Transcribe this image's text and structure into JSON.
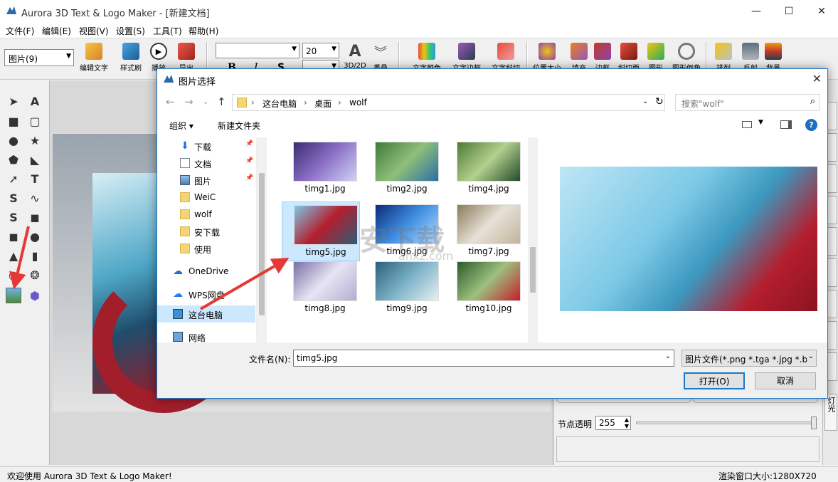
{
  "window": {
    "title": "Aurora 3D Text & Logo Maker - [新建文档]",
    "controls": [
      "minimize-icon",
      "maximize-icon",
      "close-icon"
    ]
  },
  "menu": [
    "文件(F)",
    "编辑(E)",
    "视图(V)",
    "设置(S)",
    "工具(T)",
    "帮助(H)"
  ],
  "toolbar": {
    "type_combo": "图片(9)",
    "font_size": "20",
    "buttons": [
      "编辑文字",
      "样式刷",
      "播放",
      "导出"
    ],
    "format_labels": [
      "B",
      "I",
      "S"
    ],
    "align_labels": [
      "3D/2D",
      "重叠"
    ],
    "text_buttons": [
      "文字颜色",
      "文字边框",
      "文字斜切"
    ],
    "shape_buttons": [
      "位置大小",
      "填充",
      "边框",
      "斜切面",
      "图形",
      "图形倒角"
    ],
    "scene_buttons": [
      "排列",
      "反射",
      "背景"
    ]
  },
  "right_panel": {
    "node_opacity_label": "节点透明",
    "node_opacity_value": "255",
    "tab_bottom_label": "灯光"
  },
  "status": {
    "welcome": "欢迎使用 Aurora 3D Text & Logo Maker!",
    "render_size": "渲染窗口大小:1280X720"
  },
  "dialog": {
    "title": "图片选择",
    "breadcrumb": [
      "这台电脑",
      "桌面",
      "wolf"
    ],
    "search_placeholder": "搜索\"wolf\"",
    "organize": "组织 ▾",
    "new_folder": "新建文件夹",
    "tree": [
      {
        "label": "下载",
        "icon": "download-icon",
        "pinned": true
      },
      {
        "label": "文档",
        "icon": "document-icon",
        "pinned": true
      },
      {
        "label": "图片",
        "icon": "picture-folder-icon",
        "pinned": true
      },
      {
        "label": "WeiC",
        "icon": "folder-icon",
        "pinned": false
      },
      {
        "label": "wolf",
        "icon": "folder-icon",
        "pinned": false
      },
      {
        "label": "安下载",
        "icon": "folder-icon",
        "pinned": false
      },
      {
        "label": "使用",
        "icon": "folder-icon",
        "pinned": false
      },
      {
        "label": "OneDrive",
        "icon": "cloud-icon",
        "pinned": false
      },
      {
        "label": "WPS网盘",
        "icon": "cloud-icon",
        "pinned": false
      },
      {
        "label": "这台电脑",
        "icon": "computer-icon",
        "pinned": false,
        "selected": true
      },
      {
        "label": "网络",
        "icon": "network-icon",
        "pinned": false
      }
    ],
    "files": [
      {
        "name": "timg1.jpg",
        "colors": [
          "#3a2c6e",
          "#8d70c8",
          "#cfd4f2"
        ]
      },
      {
        "name": "timg2.jpg",
        "colors": [
          "#3f7a3b",
          "#8fbf78",
          "#2a6fa6"
        ]
      },
      {
        "name": "timg4.jpg",
        "colors": [
          "#4c7b35",
          "#b3d08e",
          "#234a2a"
        ]
      },
      {
        "name": "timg5.jpg",
        "colors": [
          "#7cc8e6",
          "#b41e2d",
          "#2b5c7a"
        ],
        "selected": true
      },
      {
        "name": "timg6.jpg",
        "colors": [
          "#0b2a7a",
          "#3f8fe2",
          "#b7d8ff"
        ]
      },
      {
        "name": "timg7.jpg",
        "colors": [
          "#8d7a5c",
          "#e6e1d7",
          "#c2b49b"
        ]
      },
      {
        "name": "timg8.jpg",
        "colors": [
          "#7a6fa4",
          "#e7e5f4",
          "#b2add2"
        ]
      },
      {
        "name": "timg9.jpg",
        "colors": [
          "#2d5f7a",
          "#7bb2c7",
          "#e9eff2"
        ]
      },
      {
        "name": "timg10.jpg",
        "colors": [
          "#2e5a2a",
          "#9dc07e",
          "#c51e2a"
        ]
      }
    ],
    "filename_label": "文件名(N):",
    "filename_value": "timg5.jpg",
    "filter_value": "图片文件(*.png *.tga *.jpg *.b",
    "open_button": "打开(O)",
    "cancel_button": "取消"
  },
  "watermark": {
    "text": "安下载",
    "sub": "anxz.com"
  }
}
